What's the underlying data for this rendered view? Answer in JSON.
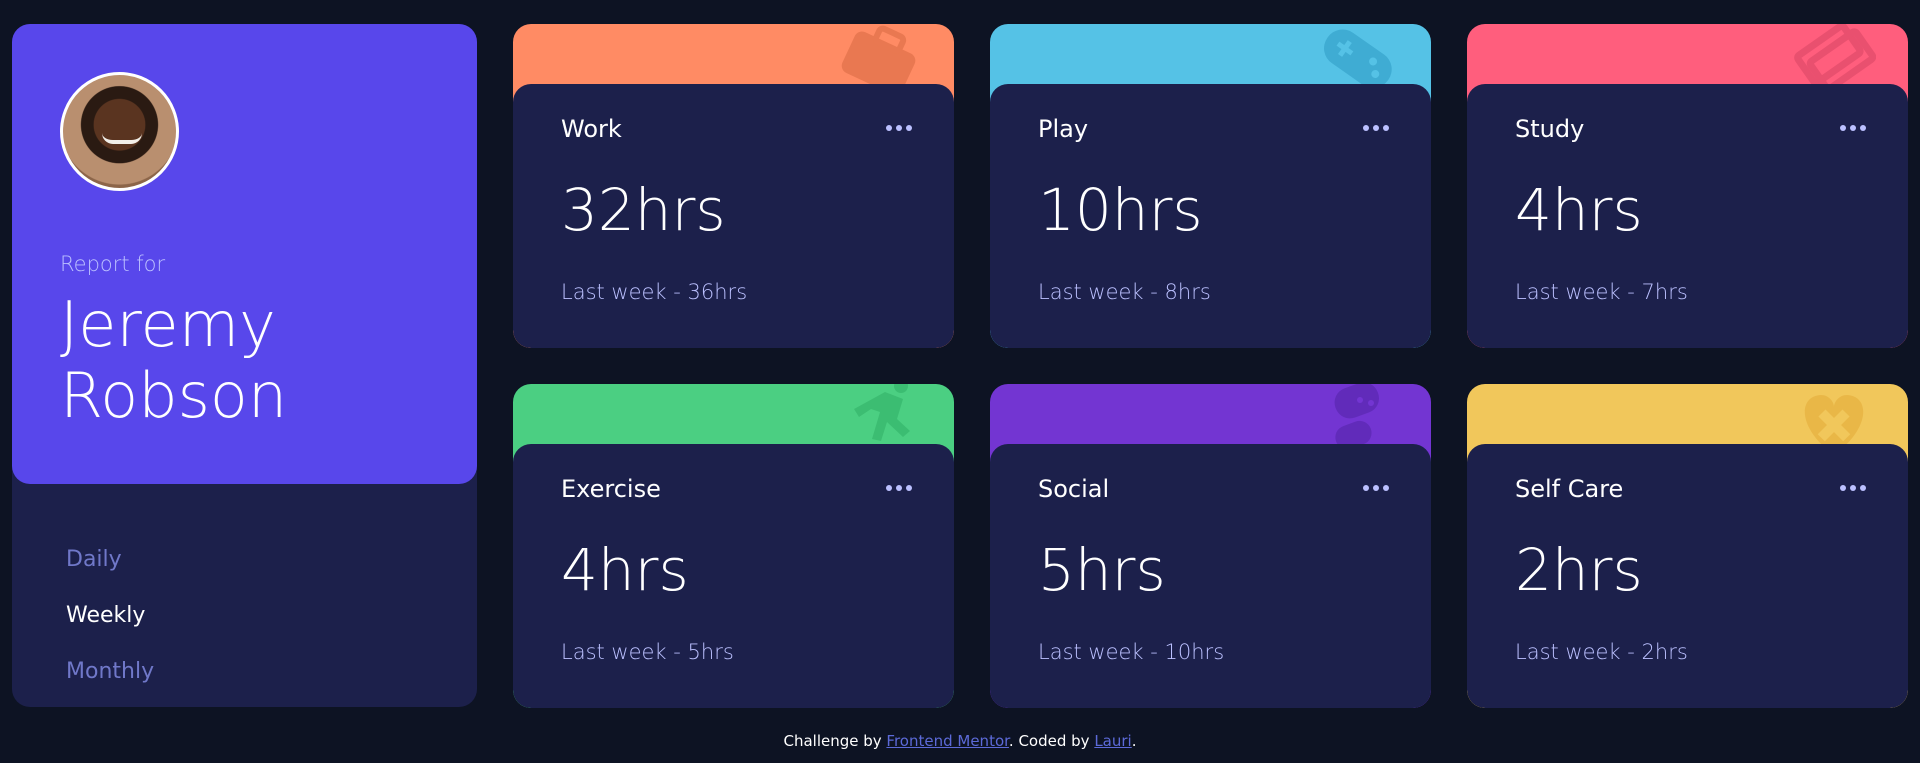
{
  "profile": {
    "report_label": "Report for",
    "name": "Jeremy Robson",
    "avatar_alt": "avatar"
  },
  "periods": [
    {
      "label": "Daily",
      "active": false
    },
    {
      "label": "Weekly",
      "active": true
    },
    {
      "label": "Monthly",
      "active": false
    }
  ],
  "cards": [
    {
      "title": "Work",
      "current": "32hrs",
      "previous": "Last week - 36hrs",
      "color": "#ff8b64",
      "icon": "briefcase-icon"
    },
    {
      "title": "Play",
      "current": "10hrs",
      "previous": "Last week - 8hrs",
      "color": "#55c2e6",
      "icon": "gamepad-icon"
    },
    {
      "title": "Study",
      "current": "4hrs",
      "previous": "Last week - 7hrs",
      "color": "#ff5e7d",
      "icon": "books-icon"
    },
    {
      "title": "Exercise",
      "current": "4hrs",
      "previous": "Last week - 5hrs",
      "color": "#4bcf82",
      "icon": "runner-icon"
    },
    {
      "title": "Social",
      "current": "5hrs",
      "previous": "Last week - 10hrs",
      "color": "#7335d2",
      "icon": "chat-icon"
    },
    {
      "title": "Self Care",
      "current": "2hrs",
      "previous": "Last week - 2hrs",
      "color": "#f1c75b",
      "icon": "heart-icon"
    }
  ],
  "footer": {
    "prefix": "Challenge by ",
    "challenge_link": "Frontend Mentor",
    "middle": ". Coded by ",
    "coder_link": "Lauri",
    "suffix": "."
  },
  "colors": {
    "page_background": "#0d1323",
    "panel": "#1c204b",
    "profile_accent": "#5847eb",
    "muted_text": "#bbc0ff",
    "inactive_nav": "#7078c9"
  }
}
